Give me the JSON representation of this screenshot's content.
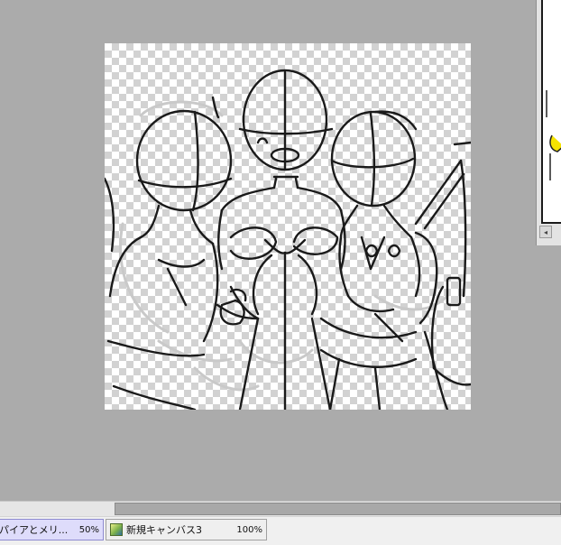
{
  "workspace": {
    "background": "#ababab",
    "canvas": {
      "transparency_pattern": "checkerboard"
    }
  },
  "navigator": {
    "scroll_left_icon": "chevron-left-icon",
    "scroll_left_glyph": "◂"
  },
  "scrollbar": {
    "orientation": "horizontal"
  },
  "tabs": [
    {
      "label": "パイアとメリ...",
      "zoom": "50%",
      "active": true
    },
    {
      "label": "新規キャンバス3",
      "zoom": "100%",
      "active": false,
      "icon": "image-icon"
    }
  ]
}
